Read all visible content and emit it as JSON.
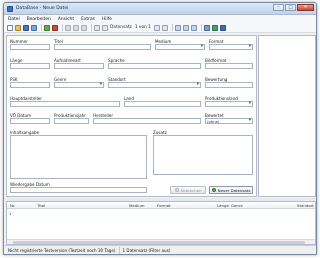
{
  "window": {
    "title": "DataBase - Neue Datei"
  },
  "menu": [
    "Datei",
    "Bearbeiten",
    "Ansicht",
    "Extras",
    "Hilfe"
  ],
  "toolbar": {
    "record_label": "Datensatz",
    "position": "1 von 1"
  },
  "form": {
    "nummer": "Nummer",
    "titel": "Titel",
    "medium": "Medium",
    "format": "Format",
    "laenge": "Länge",
    "aufnahmeart": "Aufnahmeart",
    "sprache": "Sprache",
    "bildformat": "Bildformat",
    "fsk": "FSK",
    "genre": "Genre",
    "standort": "Standort",
    "bewertung": "Bewertung",
    "hauptdarsteller": "Hauptdarsteller",
    "land": "Land",
    "produktionsland": "Produktionsland",
    "vo_datum": "VÖ Datum",
    "produktionsjahr": "Produktionsjahr",
    "hersteller": "Hersteller",
    "bewertet": "Bewertet",
    "bewertet_value": "(ohne)",
    "inhaltsangabe": "Inhaltsangabe",
    "zusatz": "Zusatz",
    "wiedergabe_datum": "Wiedergabe Datum",
    "abbrechen_button": "Abbrechen",
    "neuer_datensatz_button": "Neuer Datensatz"
  },
  "list": {
    "row_marker": "1",
    "columns": [
      "Nr.",
      "Titel",
      "Medium",
      "Format",
      "Länge",
      "Genre",
      "Standort"
    ]
  },
  "status": {
    "left": "Nicht registrierte Testversion (Testzeit noch 30 Tage)",
    "right": "1 Datensatz (Filter aus)"
  },
  "colors": {
    "accent": "#3d6fb5",
    "window_border": "#7a8ba5",
    "close_red": "#c24a36"
  }
}
